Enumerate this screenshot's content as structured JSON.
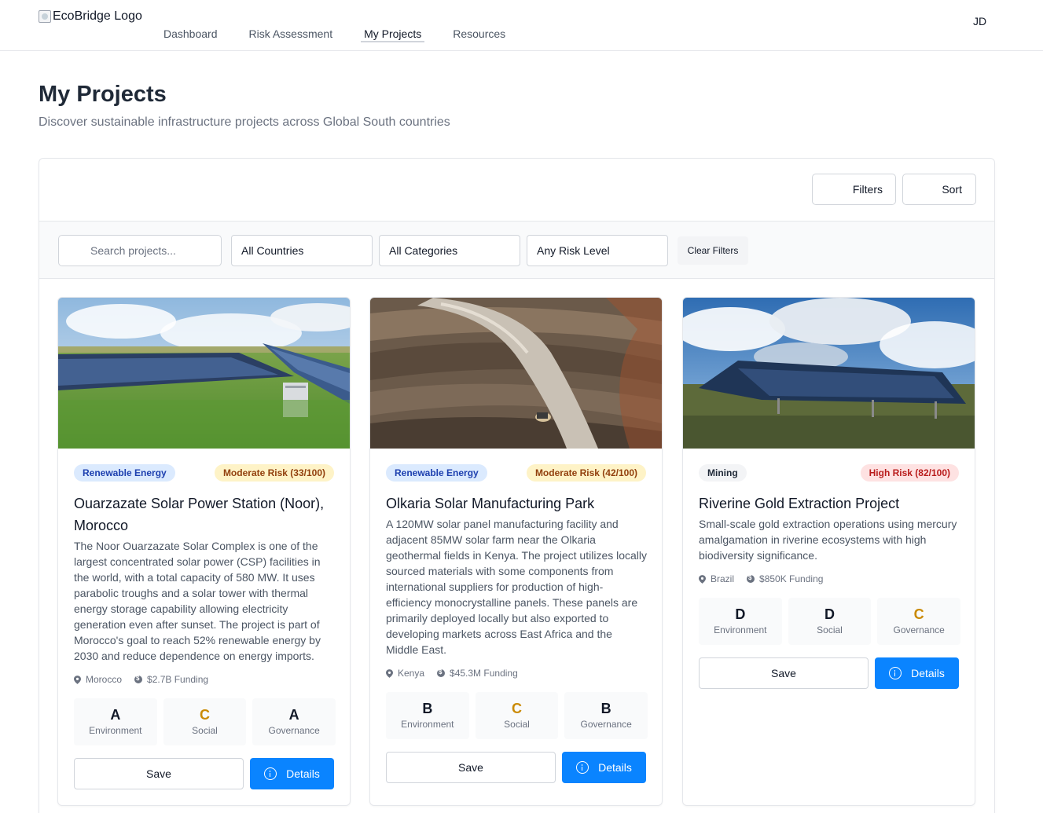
{
  "header": {
    "logo_alt": "EcoBridge Logo",
    "nav": [
      "Dashboard",
      "Risk Assessment",
      "My Projects",
      "Resources"
    ],
    "active_nav": "My Projects",
    "user_initials": "JD"
  },
  "page": {
    "title": "My Projects",
    "subtitle": "Discover sustainable infrastructure projects across Global South countries"
  },
  "toolbar": {
    "filters_label": "Filters",
    "sort_label": "Sort"
  },
  "filters": {
    "search_placeholder": "Search projects...",
    "country": "All Countries",
    "category": "All Categories",
    "risk": "Any Risk Level",
    "clear_label": "Clear Filters"
  },
  "colors": {
    "accent": "#0a84ff",
    "renewable_chip_bg": "#dbeafe",
    "renewable_chip_text": "#1e40af",
    "moderate_chip_bg": "#fef3c7",
    "moderate_chip_text": "#92400e",
    "high_chip_bg": "#fee2e2",
    "high_chip_text": "#b91c1c",
    "mining_chip_bg": "#f3f4f6",
    "mining_chip_text": "#1f2937",
    "grade_c": "#ca8a04"
  },
  "projects": [
    {
      "category": "Renewable Energy",
      "risk": "Moderate Risk (33/100)",
      "title": "Ouarzazate Solar Power Station (Noor), Morocco",
      "description": "The Noor Ouarzazate Solar Complex is one of the largest concentrated solar power (CSP) facilities in the world, with a total capacity of 580 MW. It uses parabolic troughs and a solar tower with thermal energy storage capability allowing electricity generation even after sunset. The project is part of Morocco's goal to reach 52% renewable energy by 2030 and reduce dependence on energy imports.",
      "country": "Morocco",
      "funding": "$2.7B Funding",
      "scores": [
        {
          "grade": "A",
          "label": "Environment"
        },
        {
          "grade": "C",
          "label": "Social"
        },
        {
          "grade": "A",
          "label": "Governance"
        }
      ],
      "save_label": "Save",
      "details_label": "Details",
      "image_subject": "solar panels on green field"
    },
    {
      "category": "Renewable Energy",
      "risk": "Moderate Risk (42/100)",
      "title": "Olkaria Solar Manufacturing Park",
      "description": "A 120MW solar panel manufacturing facility and adjacent 85MW solar farm near the Olkaria geothermal fields in Kenya. The project utilizes locally sourced materials with some components from international suppliers for production of high-efficiency monocrystalline panels. These panels are primarily deployed locally but also exported to developing markets across East Africa and the Middle East.",
      "country": "Kenya",
      "funding": "$45.3M Funding",
      "scores": [
        {
          "grade": "B",
          "label": "Environment"
        },
        {
          "grade": "C",
          "label": "Social"
        },
        {
          "grade": "B",
          "label": "Governance"
        }
      ],
      "save_label": "Save",
      "details_label": "Details",
      "image_subject": "open pit mine with road"
    },
    {
      "category": "Mining",
      "risk": "High Risk (82/100)",
      "title": "Riverine Gold Extraction Project",
      "description": "Small-scale gold extraction operations using mercury amalgamation in riverine ecosystems with high biodiversity significance.",
      "country": "Brazil",
      "funding": "$850K Funding",
      "scores": [
        {
          "grade": "D",
          "label": "Environment"
        },
        {
          "grade": "D",
          "label": "Social"
        },
        {
          "grade": "C",
          "label": "Governance"
        }
      ],
      "save_label": "Save",
      "details_label": "Details",
      "image_subject": "solar panel array under cloudy sky"
    }
  ]
}
